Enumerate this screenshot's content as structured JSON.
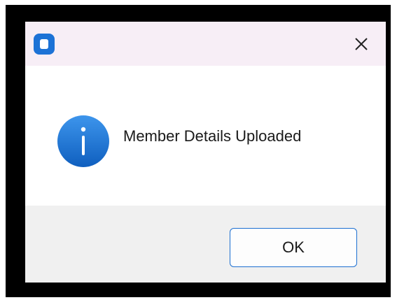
{
  "dialog": {
    "app_icon": "app-window-icon",
    "close_icon": "close-icon",
    "message_icon": "info-icon",
    "message": "Member Details Uploaded",
    "ok_label": "OK"
  },
  "colors": {
    "titlebar_bg": "#f7eef6",
    "accent": "#1c72d6",
    "footer_bg": "#f0f0f0",
    "frame": "#000000"
  }
}
